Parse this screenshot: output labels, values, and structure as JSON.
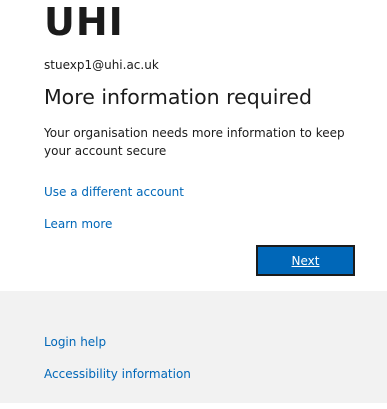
{
  "brand": {
    "logo_text": "UHI"
  },
  "signin": {
    "account_email": "stuexp1@uhi.ac.uk",
    "title": "More information required",
    "description": "Your organisation needs more information to keep your account secure",
    "different_account_link": "Use a different account",
    "learn_more_link": "Learn more",
    "next_button": "Next"
  },
  "footer": {
    "login_help": "Login help",
    "accessibility": "Accessibility information"
  },
  "colors": {
    "accent": "#0067b8",
    "text": "#1b1b1b",
    "footer_bg": "#f2f2f2"
  }
}
